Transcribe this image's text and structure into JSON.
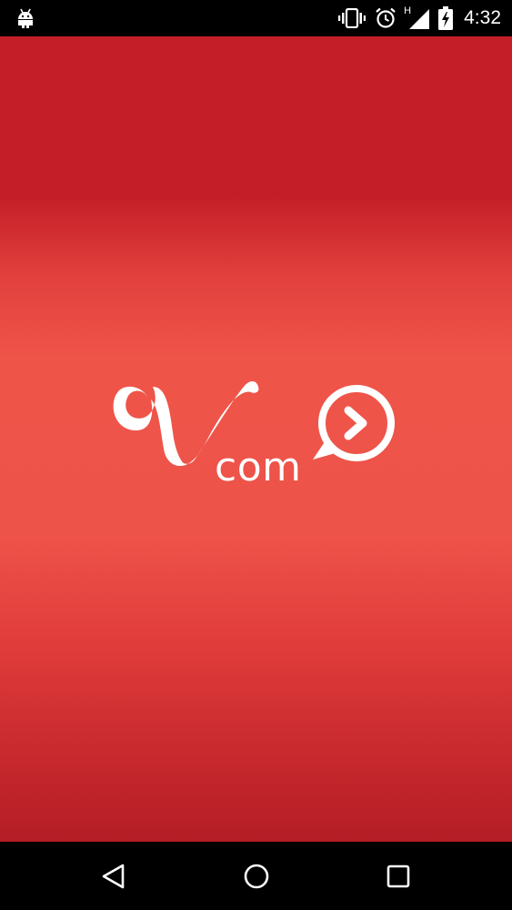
{
  "status_bar": {
    "left_icons": [
      "android-icon"
    ],
    "right_icons": [
      "vibrate-icon",
      "alarm-icon",
      "signal-icon",
      "battery-charging-icon"
    ],
    "network_label": "H",
    "time": "4:32"
  },
  "splash": {
    "logo_text": "com",
    "colors": {
      "top": "#c41f28",
      "middle": "#ef5449",
      "bottom": "#b41d25",
      "logo": "#ffffff"
    }
  },
  "nav_bar": {
    "buttons": [
      "back-icon",
      "home-icon",
      "recents-icon"
    ]
  }
}
